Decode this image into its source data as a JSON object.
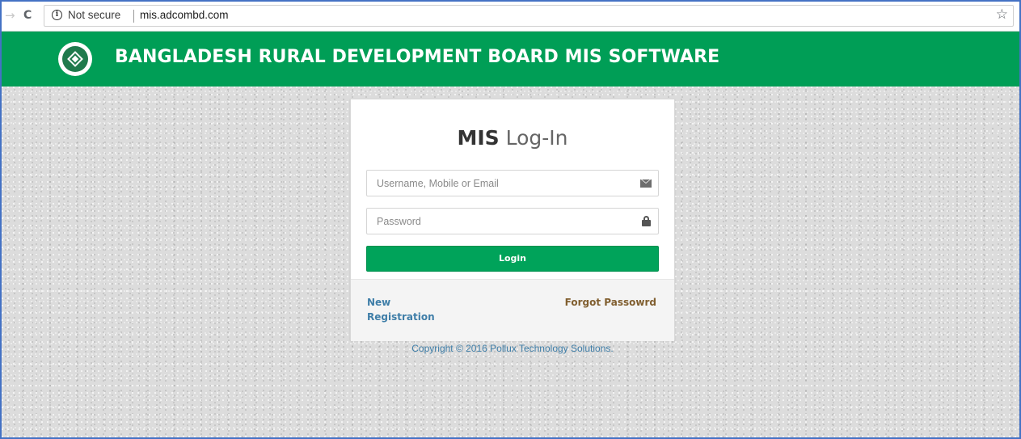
{
  "browser": {
    "security_label": "Not secure",
    "url": "mis.adcombd.com",
    "info_icon": "info-icon",
    "star_icon": "star-icon",
    "reload_icon": "reload-icon",
    "forward_icon": "forward-arrow-icon"
  },
  "header": {
    "title": "BANGLADESH RURAL DEVELOPMENT BOARD MIS SOFTWARE",
    "brand_color": "#009e56"
  },
  "login": {
    "title_strong": "MIS",
    "title_light": "Log-In",
    "username_placeholder": "Username, Mobile or Email",
    "password_placeholder": "Password",
    "username_value": "",
    "password_value": "",
    "login_label": "Login",
    "new_registration_label": "New Registration",
    "forgot_password_label": "Forgot Passowrd",
    "button_color": "#00a35a",
    "link_color": "#3f7ea8"
  },
  "footer": {
    "copyright": "Copyright © 2016 Pollux Technology Solutions."
  }
}
